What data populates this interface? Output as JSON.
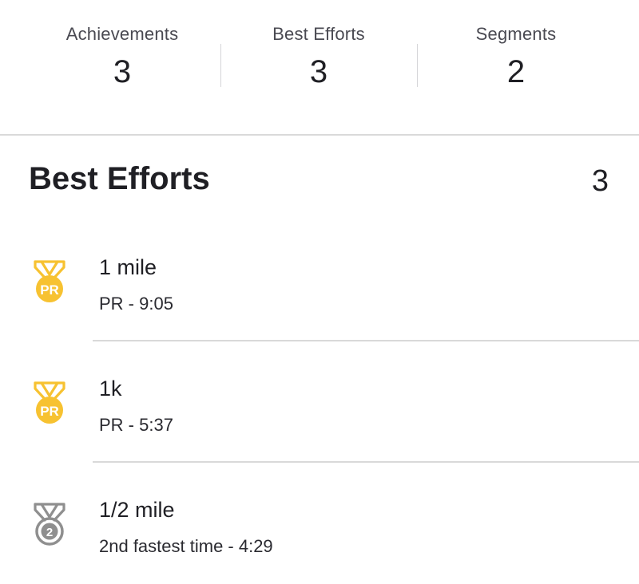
{
  "stats": [
    {
      "label": "Achievements",
      "value": "3"
    },
    {
      "label": "Best Efforts",
      "value": "3"
    },
    {
      "label": "Segments",
      "value": "2"
    }
  ],
  "section": {
    "title": "Best Efforts",
    "count": "3"
  },
  "efforts": [
    {
      "name": "1 mile",
      "detail": "PR - 9:05",
      "medal_icon": "pr-medal-gold-icon",
      "medal_text": "PR",
      "medal_color": "#F7C231"
    },
    {
      "name": "1k",
      "detail": "PR - 5:37",
      "medal_icon": "pr-medal-gold-icon",
      "medal_text": "PR",
      "medal_color": "#F7C231"
    },
    {
      "name": "1/2 mile",
      "detail": "2nd fastest time - 4:29",
      "medal_icon": "second-place-medal-silver-icon",
      "medal_text": "2",
      "medal_color": "#8F8F8F"
    }
  ]
}
